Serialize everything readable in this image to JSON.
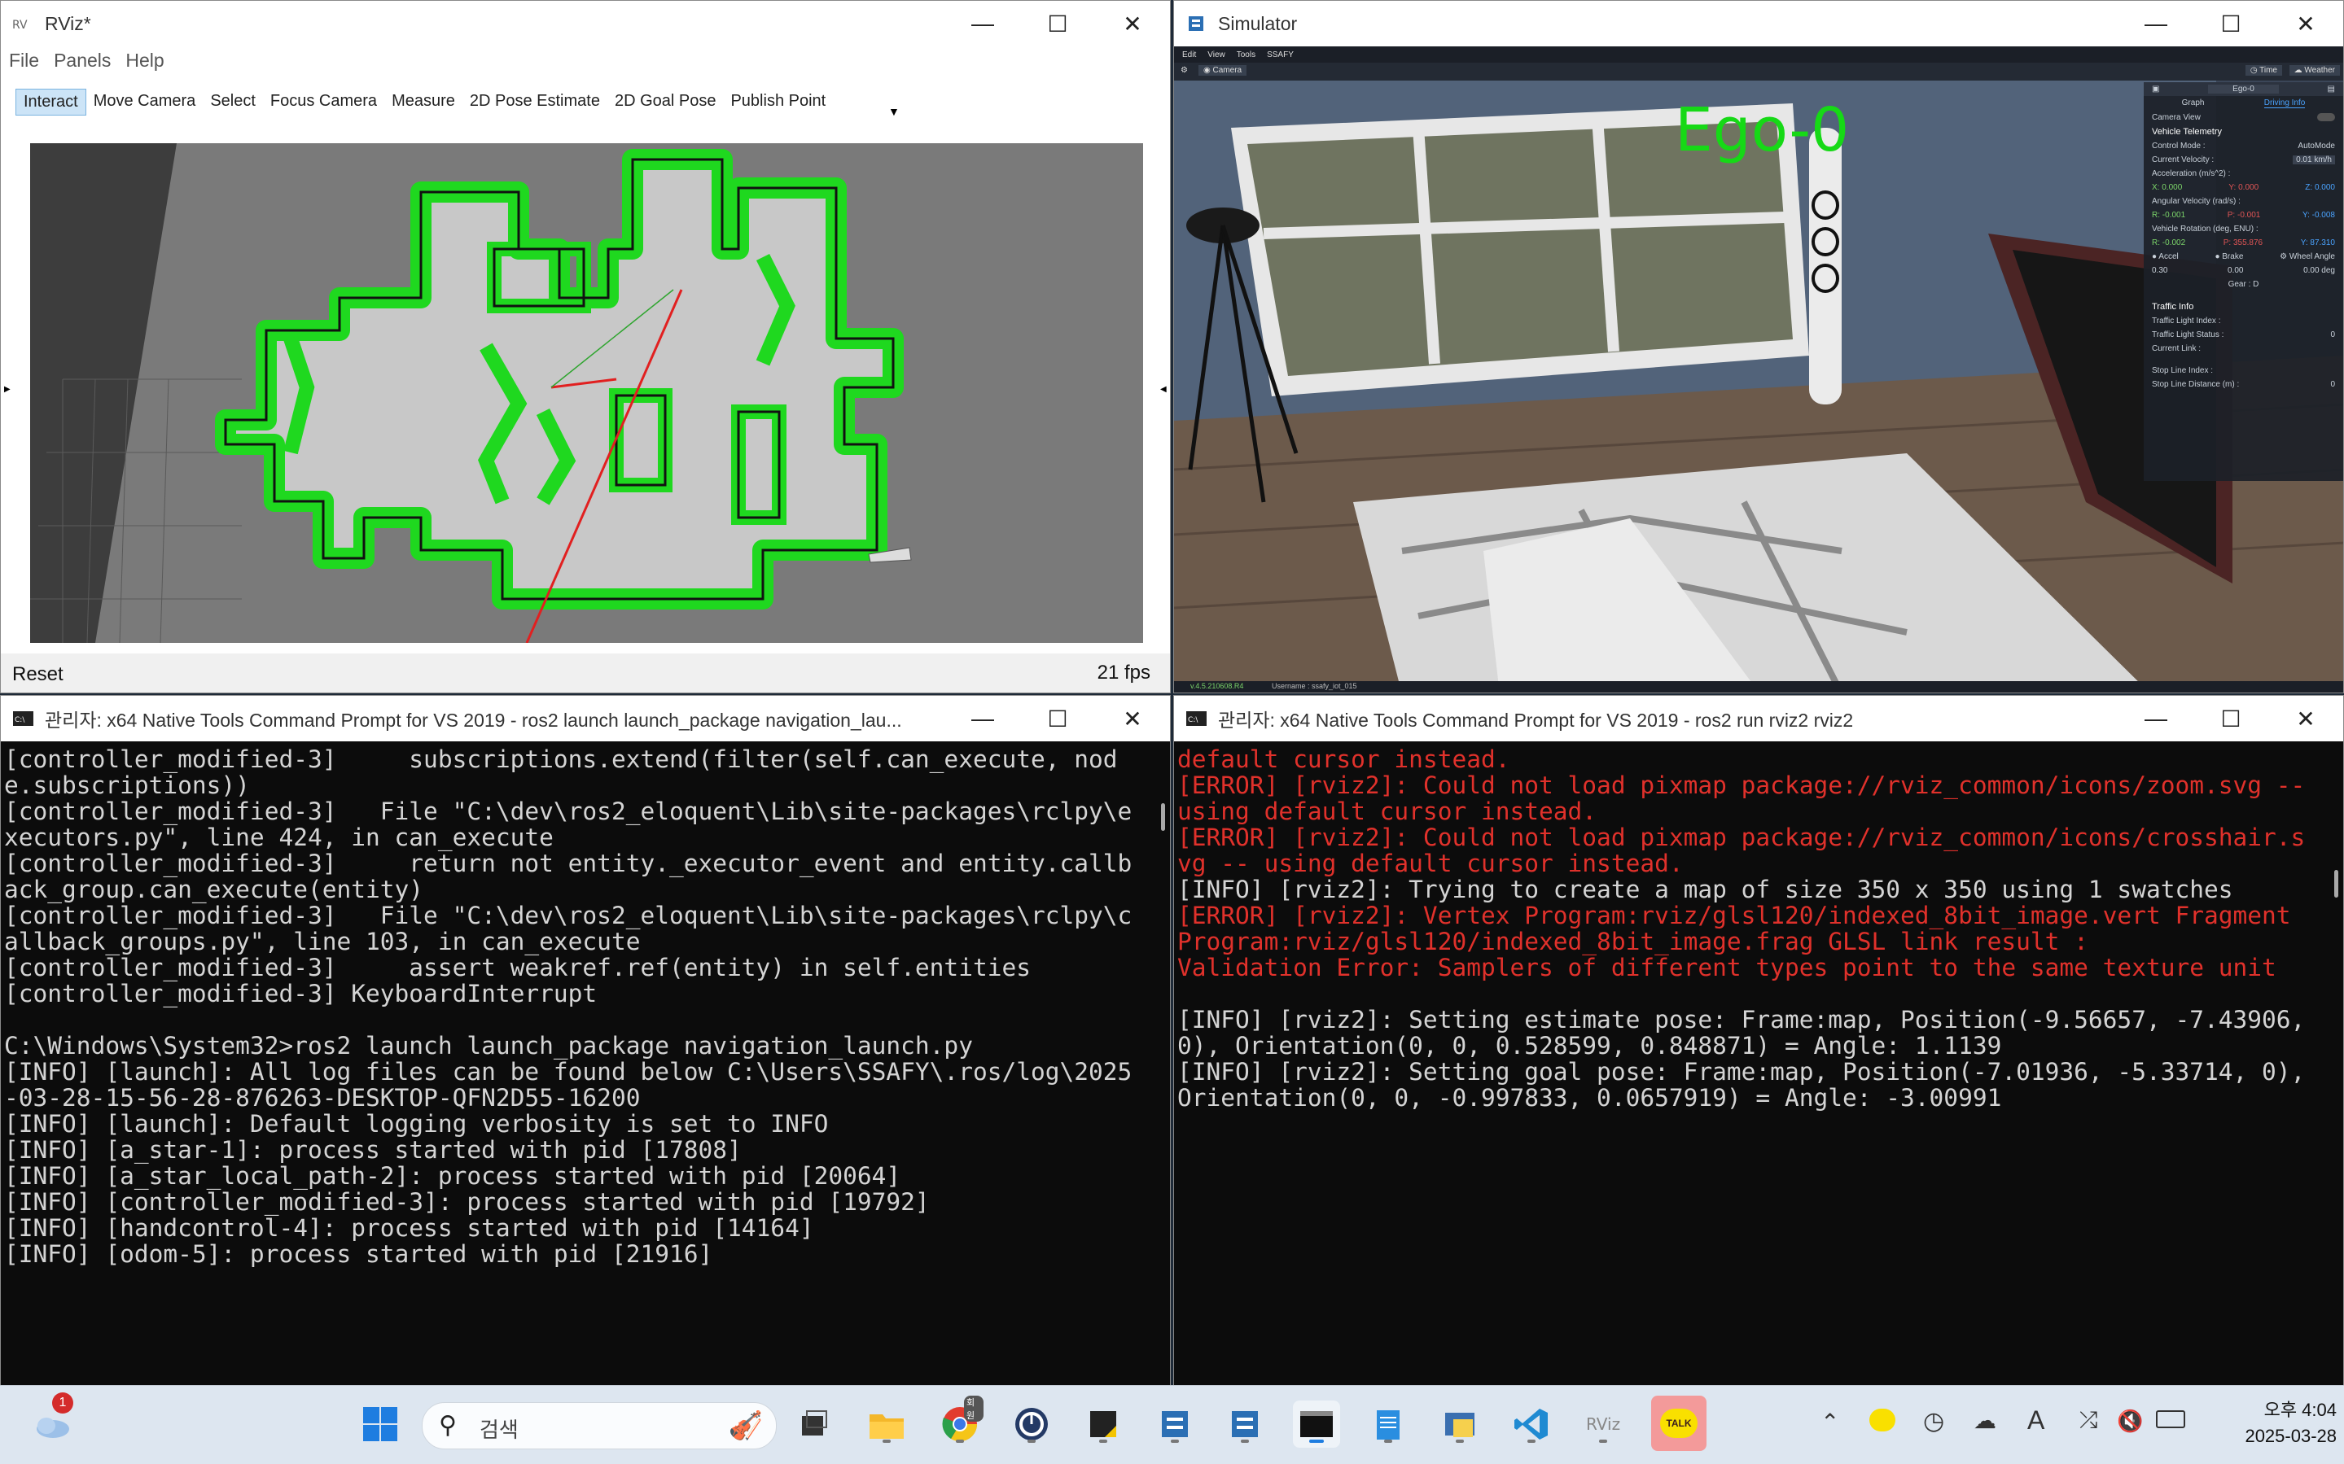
{
  "rviz": {
    "title": "RViz*",
    "menu": [
      "File",
      "Panels",
      "Help"
    ],
    "tools": [
      "Interact",
      "Move Camera",
      "Select",
      "Focus Camera",
      "Measure",
      "2D Pose Estimate",
      "2D Goal Pose",
      "Publish Point"
    ],
    "reset_label": "Reset",
    "fps": "21 fps"
  },
  "simulator": {
    "title": "Simulator",
    "menu": [
      "Edit",
      "View",
      "Tools",
      "SSAFY"
    ],
    "camera_label": "Camera",
    "time_label": "Time",
    "weather_label": "Weather",
    "ego_label": "Ego-0",
    "status_left": "v.4.5.210608.R4",
    "status_user": "Username : ssafy_iot_015",
    "panel": {
      "dropdown": "Ego-0",
      "tabs": [
        "Graph",
        "Driving Info"
      ],
      "camera_view": "Camera View",
      "vehicle_telemetry": "Vehicle Telemetry",
      "control_mode_label": "Control Mode :",
      "control_mode_value": "AutoMode",
      "current_velocity_label": "Current Velocity :",
      "current_velocity_value": "0.01 km/h",
      "acceleration_label": "Acceleration (m/s^2) :",
      "accel_x": "0.000",
      "accel_y": "0.000",
      "accel_z": "0.000",
      "angular_label": "Angular Velocity (rad/s) :",
      "ang_r": "-0.001",
      "ang_p": "-0.001",
      "ang_y": "-0.008",
      "rotation_label": "Vehicle Rotation (deg, ENU) :",
      "rot_r": "-0.002",
      "rot_p": "355.876",
      "rot_y": "87.310",
      "accel_btn": "Accel",
      "brake_btn": "Brake",
      "wheel_btn": "Wheel Angle",
      "accel_val": "0.30",
      "brake_val": "0.00",
      "wheel_val": "0.00 deg",
      "gear": "Gear : D",
      "traffic_info": "Traffic Info",
      "traffic_light_index": "Traffic Light Index :",
      "traffic_light_status": "Traffic Light Status :",
      "traffic_light_status_value": "0",
      "current_link": "Current Link :",
      "stop_line_index": "Stop Line Index :",
      "stop_line_distance": "Stop Line Distance (m) :",
      "stop_line_distance_value": "0"
    }
  },
  "cmd_left": {
    "title": "관리자: x64 Native Tools Command Prompt for VS 2019 - ros2  launch launch_package navigation_lau...",
    "lines": [
      "[controller_modified-3]     subscriptions.extend(filter(self.can_execute, node.subscriptions))",
      "[controller_modified-3]   File \"C:\\dev\\ros2_eloquent\\Lib\\site-packages\\rclpy\\executors.py\", line 424, in can_execute",
      "[controller_modified-3]     return not entity._executor_event and entity.callback_group.can_execute(entity)",
      "[controller_modified-3]   File \"C:\\dev\\ros2_eloquent\\Lib\\site-packages\\rclpy\\callback_groups.py\", line 103, in can_execute",
      "[controller_modified-3]     assert weakref.ref(entity) in self.entities",
      "[controller_modified-3] KeyboardInterrupt",
      "",
      "C:\\Windows\\System32>ros2 launch launch_package navigation_launch.py",
      "[INFO] [launch]: All log files can be found below C:\\Users\\SSAFY\\.ros/log\\2025-03-28-15-56-28-876263-DESKTOP-QFN2D55-16200",
      "[INFO] [launch]: Default logging verbosity is set to INFO",
      "[INFO] [a_star-1]: process started with pid [17808]",
      "[INFO] [a_star_local_path-2]: process started with pid [20064]",
      "[INFO] [controller_modified-3]: process started with pid [19792]",
      "[INFO] [handcontrol-4]: process started with pid [14164]",
      "[INFO] [odom-5]: process started with pid [21916]"
    ]
  },
  "cmd_right": {
    "title": "관리자: x64 Native Tools Command Prompt for VS 2019 - ros2  run rviz2 rviz2",
    "lines": [
      {
        "t": "default cursor instead.",
        "err": true
      },
      {
        "t": "[ERROR] [rviz2]: Could not load pixmap package://rviz_common/icons/zoom.svg -- using default cursor instead.",
        "err": true
      },
      {
        "t": "[ERROR] [rviz2]: Could not load pixmap package://rviz_common/icons/crosshair.svg -- using default cursor instead.",
        "err": true
      },
      {
        "t": "[INFO] [rviz2]: Trying to create a map of size 350 x 350 using 1 swatches",
        "err": false
      },
      {
        "t": "[ERROR] [rviz2]: Vertex Program:rviz/glsl120/indexed_8bit_image.vert Fragment Program:rviz/glsl120/indexed_8bit_image.frag GLSL link result :",
        "err": true
      },
      {
        "t": "Validation Error: Samplers of different types point to the same texture unit",
        "err": true
      },
      {
        "t": "",
        "err": false
      },
      {
        "t": "[INFO] [rviz2]: Setting estimate pose: Frame:map, Position(-9.56657, -7.43906, 0), Orientation(0, 0, 0.528599, 0.848871) = Angle: 1.1139",
        "err": false
      },
      {
        "t": "[INFO] [rviz2]: Setting goal pose: Frame:map, Position(-7.01936, -5.33714, 0), Orientation(0, 0, -0.997833, 0.0657919) = Angle: -3.00991",
        "err": false
      }
    ]
  },
  "taskbar": {
    "weather_badge": "1",
    "search_placeholder": "검색",
    "chrome_badge": "회원",
    "kakao_label": "TALK",
    "time": "오후 4:04",
    "date": "2025-03-28"
  }
}
